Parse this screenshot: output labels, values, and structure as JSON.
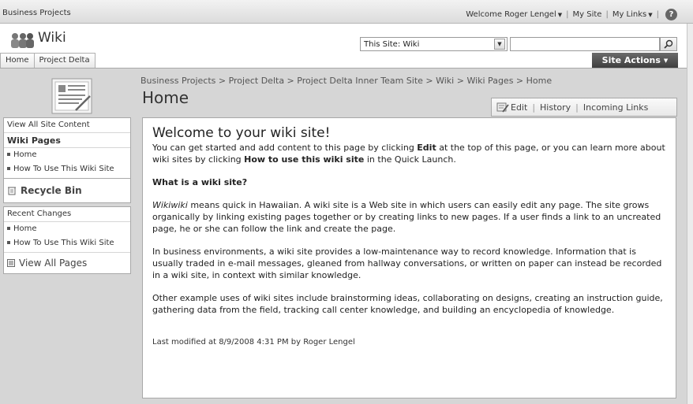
{
  "topbar": {
    "site_name": "Business Projects",
    "welcome": "Welcome Roger Lengel",
    "my_site": "My Site",
    "my_links": "My Links",
    "help": "?"
  },
  "header": {
    "wiki_title": "Wiki",
    "search_scope": "This Site: Wiki",
    "search_placeholder": ""
  },
  "tabs": [
    "Home",
    "Project Delta"
  ],
  "site_actions": "Site Actions",
  "breadcrumb": "Business Projects > Project Delta > Project Delta Inner Team Site > Wiki > Wiki Pages > Home",
  "page_title": "Home",
  "toolbar": {
    "edit": "Edit",
    "history": "History",
    "incoming": "Incoming Links"
  },
  "nav": {
    "view_all_content": "View All Site Content",
    "wiki_pages_hdr": "Wiki Pages",
    "wiki_pages": [
      "Home",
      "How To Use This Wiki Site"
    ],
    "recycle_bin": "Recycle Bin",
    "recent_changes_hdr": "Recent Changes",
    "recent_changes": [
      "Home",
      "How To Use This Wiki Site"
    ],
    "view_all_pages": "View All Pages"
  },
  "content": {
    "heading": "Welcome to your wiki site!",
    "intro_1": "You can get started and add content to this page by clicking ",
    "intro_edit": "Edit",
    "intro_2": " at the top of this page, or you can learn more about wiki sites by clicking ",
    "intro_how": "How to use this wiki site",
    "intro_3": " in the Quick Launch.",
    "subheading": "What is a wiki site?",
    "p1_em": "Wikiwiki",
    "p1": " means quick in Hawaiian. A wiki site is a Web site in which users can easily edit any page. The site grows organically by linking existing pages together or by creating links to new pages. If a user finds a link to an uncreated page, he or she can follow the link and create the page.",
    "p2": "In business environments, a wiki site provides a low-maintenance way to record knowledge. Information that is usually traded in e-mail messages, gleaned from hallway conversations, or written on paper can instead be recorded in a wiki site, in context with similar knowledge.",
    "p3": "Other example uses of wiki sites include brainstorming ideas, collaborating on designs, creating an instruction guide, gathering data from the field, tracking call center knowledge, and building an encyclopedia of knowledge.",
    "modified": "Last modified at 8/9/2008 4:31 PM  by Roger Lengel"
  }
}
